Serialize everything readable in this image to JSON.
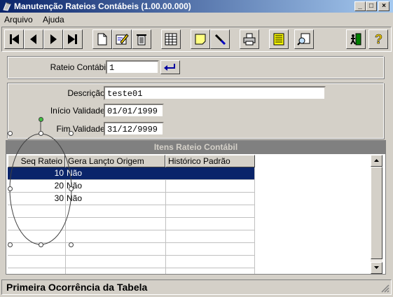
{
  "window": {
    "title": "Manutenção Rateios Contábeis (1.00.00.000)",
    "minimize": "_",
    "maximize": "□",
    "close": "×"
  },
  "menu": [
    {
      "label": "Arquivo"
    },
    {
      "label": "Ajuda"
    }
  ],
  "toolbar": {
    "icons": [
      "first-record-icon",
      "previous-record-icon",
      "next-record-icon",
      "last-record-icon",
      "new-record-icon",
      "edit-record-icon",
      "delete-record-icon",
      "table-view-icon",
      "note-icon",
      "search-icon",
      "print-icon",
      "list-icon",
      "zoom-icon",
      "exit-icon",
      "help-icon"
    ]
  },
  "header_form": {
    "rateio_label": "Rateio Contábil:",
    "rateio_value": "1"
  },
  "details_form": {
    "descricao_label": "Descrição:",
    "descricao_value": "teste01",
    "inicio_label": "Início Validade:",
    "inicio_value": "01/01/1999",
    "fim_label": "Fim Validade:",
    "fim_value": "31/12/9999"
  },
  "grid": {
    "title": "Itens Rateio Contábil",
    "columns": [
      "Seq Rateio",
      "Gera Lançto Origem",
      "Histórico Padrão"
    ],
    "rows": [
      {
        "seq": "10",
        "gera": "Não",
        "historico": ""
      },
      {
        "seq": "20",
        "gera": "Não",
        "historico": ""
      },
      {
        "seq": "30",
        "gera": "Não",
        "historico": ""
      }
    ],
    "selected_row": 0
  },
  "status": {
    "text": "Primeira Ocorrência da Tabela"
  }
}
